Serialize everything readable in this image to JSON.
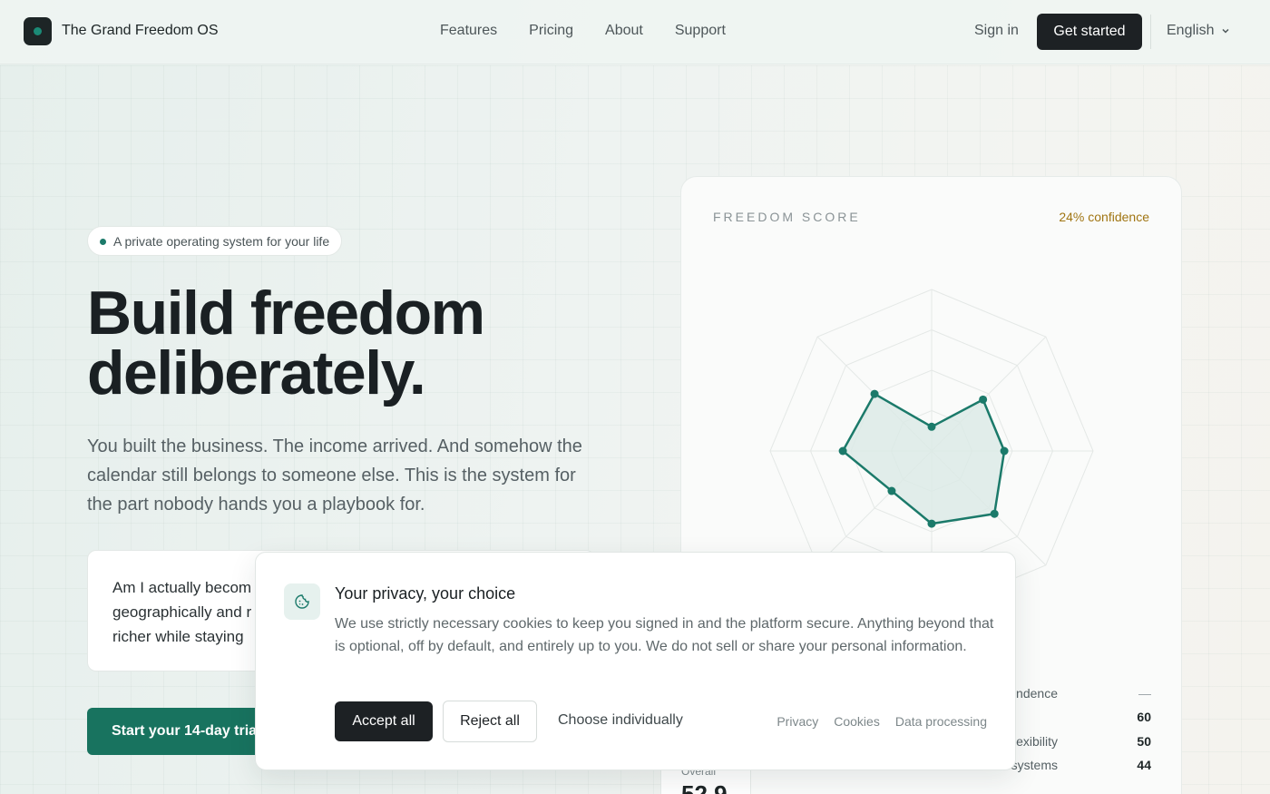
{
  "nav": {
    "brand": "The Grand Freedom OS",
    "links": [
      "Features",
      "Pricing",
      "About",
      "Support"
    ],
    "signin": "Sign in",
    "cta": "Get started",
    "language": "English"
  },
  "hero": {
    "pill": "A private operating system for your life",
    "headline_line1": "Build freedom",
    "headline_line2": "deliberately.",
    "sub": "You built the business. The income arrived. And somehow the calendar still belongs to someone else. This is the system for the part nobody hands you a playbook for.",
    "question_line1": "Am I actually becom",
    "question_line2": "geographically and r",
    "question_line3": "richer while staying",
    "trial": "Start your 14-day trial"
  },
  "score": {
    "title": "FREEDOM SCORE",
    "confidence": "24% confidence",
    "overall_label": "Overall",
    "overall_value": "52.9",
    "metrics": [
      {
        "name": "pendence",
        "value": "—"
      },
      {
        "name": "",
        "value": "60"
      },
      {
        "name": "lexibility",
        "value": "50"
      },
      {
        "name": "systems",
        "value": "44"
      }
    ],
    "radar_values": [
      0.15,
      0.45,
      0.45,
      0.55,
      0.45,
      0.35,
      0.55,
      0.5
    ],
    "colors": {
      "accent": "#1b7a6a",
      "fill": "#dbeae6"
    }
  },
  "cookie": {
    "title": "Your privacy, your choice",
    "text": "We use strictly necessary cookies to keep you signed in and the platform secure. Anything beyond that is optional, off by default, and entirely up to you. We do not sell or share your personal information.",
    "accept": "Accept all",
    "reject": "Reject all",
    "choose": "Choose individually",
    "links": [
      "Privacy",
      "Cookies",
      "Data processing"
    ]
  }
}
